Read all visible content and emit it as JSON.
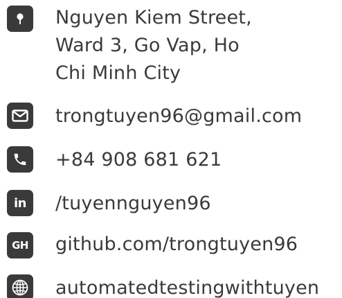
{
  "contact": {
    "address": {
      "icon": "map-pin-icon",
      "line1": "Nguyen Kiem Street,",
      "line2": "Ward 3, Go Vap, Ho",
      "line3": "Chi Minh City"
    },
    "email": {
      "icon": "envelope-icon",
      "value": "trongtuyen96@gmail.com"
    },
    "phone": {
      "icon": "phone-icon",
      "value": "+84 908 681 621"
    },
    "linkedin": {
      "icon": "linkedin-icon",
      "icon_label": "in",
      "value": "/tuyennguyen96"
    },
    "github": {
      "icon": "github-icon",
      "icon_label": "GH",
      "value": "github.com/trongtuyen96"
    },
    "website": {
      "icon": "globe-icon",
      "value": "automatedtestingwithtuyen"
    }
  },
  "colors": {
    "icon_background": "#3a3a3a",
    "text": "#3a3a3a"
  }
}
